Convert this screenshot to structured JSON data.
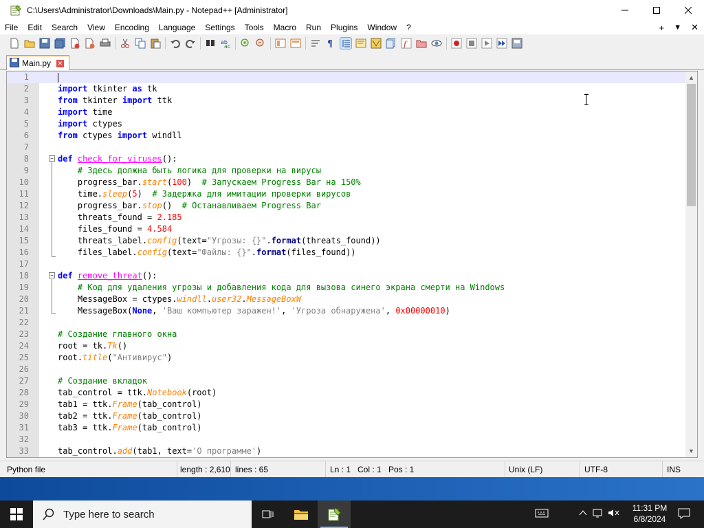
{
  "window": {
    "title": "C:\\Users\\Administrator\\Downloads\\Main.py - Notepad++ [Administrator]"
  },
  "menu": [
    "File",
    "Edit",
    "Search",
    "View",
    "Encoding",
    "Language",
    "Settings",
    "Tools",
    "Macro",
    "Run",
    "Plugins",
    "Window",
    "?"
  ],
  "menu_right": {
    "plus": "+",
    "dropdown": "▼",
    "close": "✕"
  },
  "tab": {
    "label": "Main.py"
  },
  "editor": {
    "lines": [
      {
        "n": "1",
        "html": ""
      },
      {
        "n": "2",
        "html": "<span class='k'>import</span> tkinter <span class='k'>as</span> tk"
      },
      {
        "n": "3",
        "html": "<span class='k'>from</span> tkinter <span class='k'>import</span> ttk"
      },
      {
        "n": "4",
        "html": "<span class='k'>import</span> time"
      },
      {
        "n": "5",
        "html": "<span class='k'>import</span> ctypes"
      },
      {
        "n": "6",
        "html": "<span class='k'>from</span> ctypes <span class='k'>import</span> windll"
      },
      {
        "n": "7",
        "html": ""
      },
      {
        "n": "8",
        "html": "<span class='k'>def</span> <span class='fn' style='text-decoration:underline'>check_for_viruses</span>():"
      },
      {
        "n": "9",
        "html": "    <span class='c'># Здесь должна быть логика для проверки на вирусы</span>"
      },
      {
        "n": "10",
        "html": "    progress_bar.<span class='m'>start</span>(<span class='n'>100</span>)  <span class='c'># Запускаем Progress Bar на 150%</span>"
      },
      {
        "n": "11",
        "html": "    time.<span class='m'>sleep</span>(<span class='n'>5</span>)  <span class='c'># Задержка для имитации проверки вирусов</span>"
      },
      {
        "n": "12",
        "html": "    progress_bar.<span class='m'>stop</span>()  <span class='c'># Останавливаем Progress Bar</span>"
      },
      {
        "n": "13",
        "html": "    threats_found = <span class='n'>2.185</span>"
      },
      {
        "n": "14",
        "html": "    files_found = <span class='n'>4.584</span>"
      },
      {
        "n": "15",
        "html": "    threats_label.<span class='m'>config</span>(text=<span class='s'>\"Угрозы: {}\"</span>.<span class='fmt'>format</span>(threats_found))"
      },
      {
        "n": "16",
        "html": "    files_label.<span class='m'>config</span>(text=<span class='s'>\"Файлы: {}\"</span>.<span class='fmt'>format</span>(files_found))"
      },
      {
        "n": "17",
        "html": ""
      },
      {
        "n": "18",
        "html": "<span class='k'>def</span> <span class='fn' style='text-decoration:underline'>remove_threat</span>():"
      },
      {
        "n": "19",
        "html": "    <span class='c'># Код для удаления угрозы и добавления кода для вызова синего экрана смерти на Windows</span>"
      },
      {
        "n": "20",
        "html": "    MessageBox = ctypes.<span class='m'>windll</span>.<span class='m'>user32</span>.<span class='m'>MessageBoxW</span>"
      },
      {
        "n": "21",
        "html": "    MessageBox(<span class='k'>None</span>, <span class='s'>'Ваш компьютер заражен!'</span>, <span class='s'>'Угроза обнаружена'</span>, <span class='n'>0x00000010</span>)"
      },
      {
        "n": "22",
        "html": ""
      },
      {
        "n": "23",
        "html": "<span class='c'># Создание главного окна</span>"
      },
      {
        "n": "24",
        "html": "root = tk.<span class='m'>Tk</span>()"
      },
      {
        "n": "25",
        "html": "root.<span class='m'>title</span>(<span class='s'>\"Антивирус\"</span>)"
      },
      {
        "n": "26",
        "html": ""
      },
      {
        "n": "27",
        "html": "<span class='c'># Создание вкладок</span>"
      },
      {
        "n": "28",
        "html": "tab_control = ttk.<span class='m'>Notebook</span>(root)"
      },
      {
        "n": "29",
        "html": "tab1 = ttk.<span class='m'>Frame</span>(tab_control)"
      },
      {
        "n": "30",
        "html": "tab2 = ttk.<span class='m'>Frame</span>(tab_control)"
      },
      {
        "n": "31",
        "html": "tab3 = ttk.<span class='m'>Frame</span>(tab_control)"
      },
      {
        "n": "32",
        "html": ""
      },
      {
        "n": "33",
        "html": "tab_control.<span class='m'>add</span>(tab1, text=<span class='s'>'О программе'</span>)"
      }
    ]
  },
  "status": {
    "type": "Python file",
    "length": "length : 2,610",
    "lines": "lines : 65",
    "ln": "Ln : 1",
    "col": "Col : 1",
    "pos": "Pos : 1",
    "eol": "Unix (LF)",
    "encoding": "UTF-8",
    "mode": "INS"
  },
  "taskbar": {
    "search_placeholder": "Type here to search",
    "time": "11:31 PM",
    "date": "6/8/2024"
  }
}
